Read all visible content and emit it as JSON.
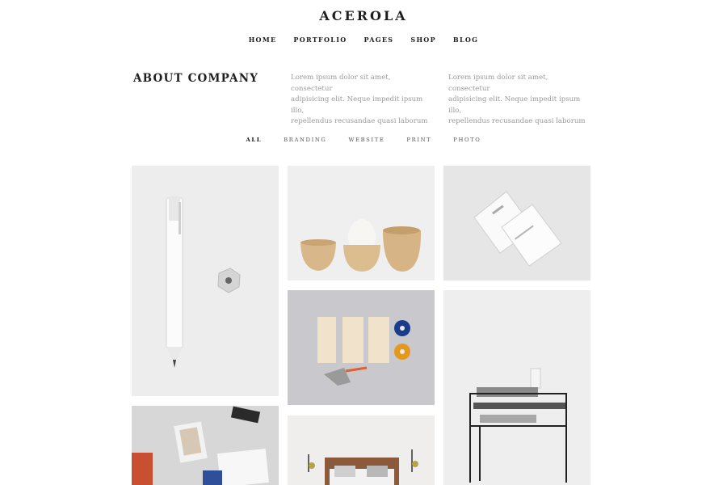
{
  "header": {
    "brand": "ACEROLA"
  },
  "nav": {
    "items": [
      "HOME",
      "PORTFOLIO",
      "PAGES",
      "SHOP",
      "BLOG"
    ]
  },
  "about": {
    "title": "ABOUT COMPANY",
    "columns": [
      [
        "Lorem ipsum dolor sit amet, consectetur",
        "adipisicing elit. Neque impedit ipsum illo,",
        "repellendus recusandae quasi laborum"
      ],
      [
        "Lorem ipsum dolor sit amet, consectetur",
        "adipisicing elit. Neque impedit ipsum illo,",
        "repellendus recusandae quasi laborum"
      ]
    ]
  },
  "filters": {
    "items": [
      "ALL",
      "BRANDING",
      "WEBSITE",
      "PRINT",
      "PHOTO"
    ],
    "active": "ALL"
  },
  "portfolio": {
    "items": [
      "pencil-and-sharpener",
      "wooden-egg-cups",
      "business-cards",
      "stationery-set",
      "metal-side-table",
      "photo-prints",
      "bedroom-interior"
    ]
  },
  "colors": {
    "text": "#1e1e1e",
    "muted": "#9a9a9a",
    "background": "#ffffff"
  }
}
